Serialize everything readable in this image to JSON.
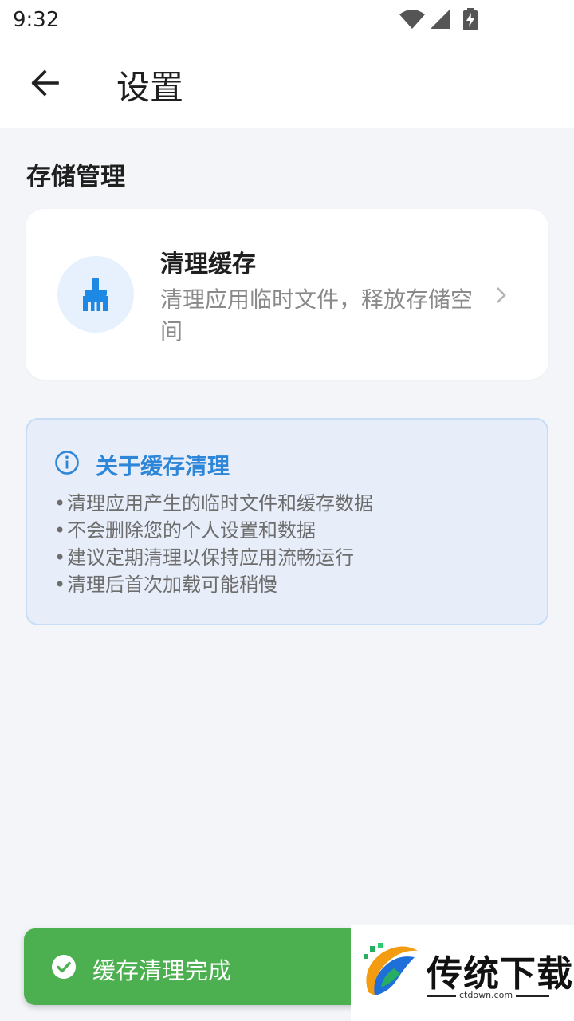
{
  "status_bar": {
    "time": "9:32",
    "icons": [
      "wifi-icon",
      "signal-icon",
      "battery-charging-icon"
    ]
  },
  "app_bar": {
    "back_icon": "arrow-left-icon",
    "title": "设置"
  },
  "storage": {
    "section_title": "存储管理",
    "clean_cache": {
      "icon": "broom-icon",
      "title": "清理缓存",
      "description": "清理应用临时文件，释放存储空间",
      "chevron_icon": "chevron-right-icon"
    }
  },
  "info": {
    "icon": "info-icon",
    "title": "关于缓存清理",
    "bullet": "•",
    "items": [
      "清理应用产生的临时文件和缓存数据",
      "不会删除您的个人设置和数据",
      "建议定期清理以保持应用流畅运行",
      "清理后首次加载可能稍慢"
    ]
  },
  "toast": {
    "icon": "check-circle-icon",
    "message": "缓存清理完成"
  },
  "watermark": {
    "brand": "传统下载",
    "url": "ctdown.com"
  },
  "colors": {
    "accent": "#2e86d8",
    "toast_bg": "#4caf50",
    "page_bg": "#f3f5f9",
    "info_bg": "#e8eef9"
  }
}
